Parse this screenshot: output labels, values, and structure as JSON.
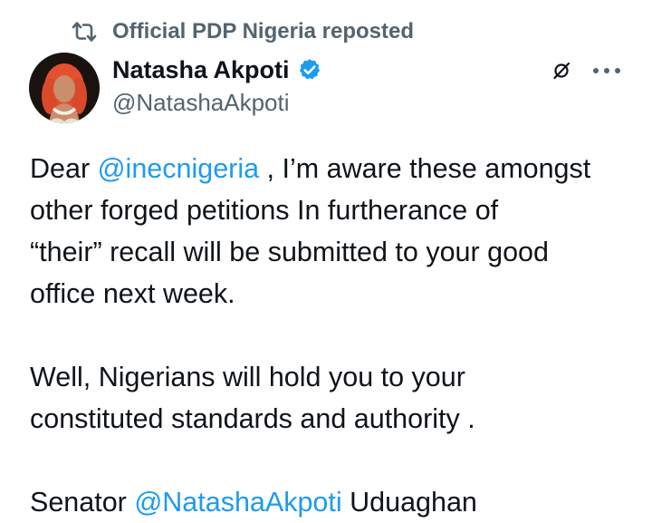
{
  "repost": {
    "text": "Official PDP Nigeria reposted"
  },
  "author": {
    "name": "Natasha Akpoti",
    "handle": "@NatashaAkpoti",
    "verified": true
  },
  "tweet": {
    "p1_prefix": "Dear ",
    "p1_mention": "@inecnigeria",
    "p1_line1_suffix": " , I’m aware these amongst",
    "p1_line2": "other forged petitions In furtherance of",
    "p1_line3": "“their” recall will be submitted to your good",
    "p1_line4": "office next week.",
    "p2_line1": "Well, Nigerians will hold you to your",
    "p2_line2": "constituted standards and authority .",
    "p3_prefix": "Senator ",
    "p3_mention": "@NatashaAkpoti",
    "p3_suffix": " Uduaghan"
  },
  "icons": {
    "repost": "repost-icon",
    "verified": "verified-badge-icon",
    "grok": "grok-icon",
    "more": "more-options-icon"
  },
  "colors": {
    "text": "#0f1419",
    "secondary": "#536471",
    "link": "#1d9bf0",
    "verified": "#1d9bf0"
  }
}
